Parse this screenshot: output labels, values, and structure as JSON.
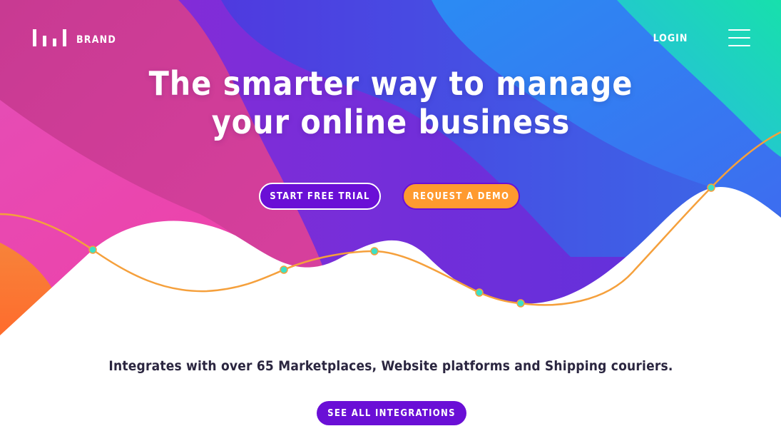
{
  "nav": {
    "brand_label": "BRAND",
    "login_label": "LOGIN",
    "menu_icon": "hamburger-menu-icon",
    "logo_icon": "bar-logo-icon"
  },
  "hero": {
    "title_line1": "The smarter way to manage",
    "title_line2": "your online business",
    "primary_cta_label": "START FREE TRIAL",
    "secondary_cta_label": "REQUEST A DEMO"
  },
  "integrations": {
    "text": "Integrates with over 65 Marketplaces, Website platforms and Shipping couriers.",
    "cta_label": "SEE ALL INTEGRATIONS"
  },
  "colors": {
    "primary_purple": "#6a0fd6",
    "accent_orange": "#ff9a2f",
    "line_orange": "#f5a03c",
    "node_teal": "#3de0c6",
    "gradient_pink": "#ee3fa6",
    "gradient_blue": "#2f8df2",
    "gradient_teal": "#1ad8b0",
    "text_dark": "#2b2640"
  }
}
